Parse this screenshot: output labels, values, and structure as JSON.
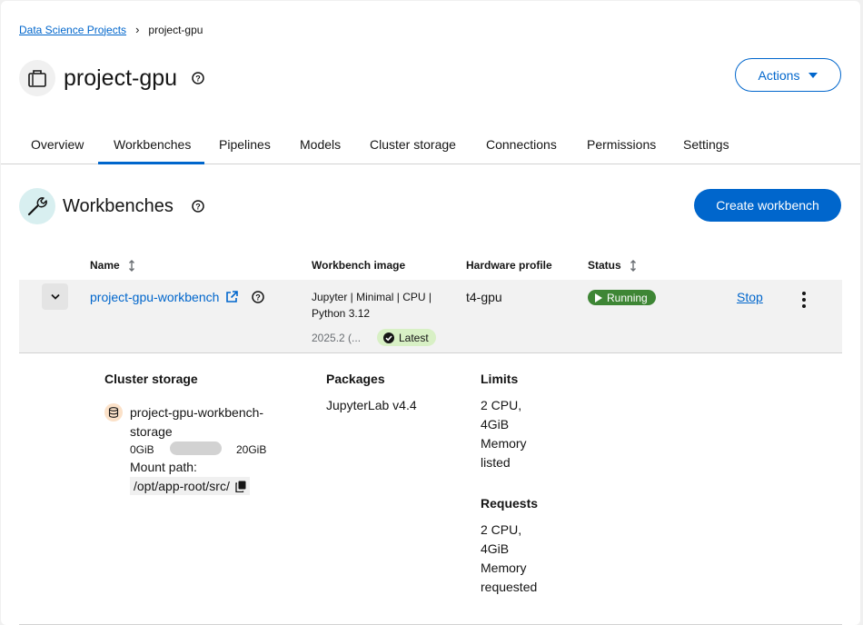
{
  "breadcrumb": {
    "parent": "Data Science Projects",
    "current": "project-gpu"
  },
  "header": {
    "title": "project-gpu",
    "actions_label": "Actions"
  },
  "tabs": [
    {
      "label": "Overview"
    },
    {
      "label": "Workbenches",
      "active": true
    },
    {
      "label": "Pipelines"
    },
    {
      "label": "Models"
    },
    {
      "label": "Cluster storage"
    },
    {
      "label": "Connections"
    },
    {
      "label": "Permissions"
    },
    {
      "label": "Settings"
    }
  ],
  "section": {
    "title": "Workbenches",
    "create_label": "Create workbench"
  },
  "table": {
    "columns": {
      "name": "Name",
      "image": "Workbench image",
      "hardware": "Hardware profile",
      "status": "Status"
    },
    "row": {
      "name": "project-gpu-workbench",
      "image": "Jupyter | Minimal | CPU | Python 3.12",
      "image_version": "2025.2 (...",
      "image_badge": "Latest",
      "hardware": "t4-gpu",
      "status": "Running",
      "stop_label": "Stop"
    }
  },
  "details": {
    "cluster_storage": {
      "heading": "Cluster storage",
      "name": "project-gpu-workbench-storage",
      "min": "0GiB",
      "max": "20GiB",
      "used_fraction": 0,
      "mount_label": "Mount path:",
      "mount_path": "/opt/app-root/src/"
    },
    "packages": {
      "heading": "Packages",
      "value": "JupyterLab v4.4"
    },
    "limits": {
      "heading": "Limits",
      "value": "2 CPU, 4GiB Memory listed"
    },
    "requests": {
      "heading": "Requests",
      "value": "2 CPU, 4GiB Memory requested"
    }
  },
  "colors": {
    "accent": "#0066cc",
    "running": "#3e8635",
    "latest_badge": "#d8f0c5"
  }
}
